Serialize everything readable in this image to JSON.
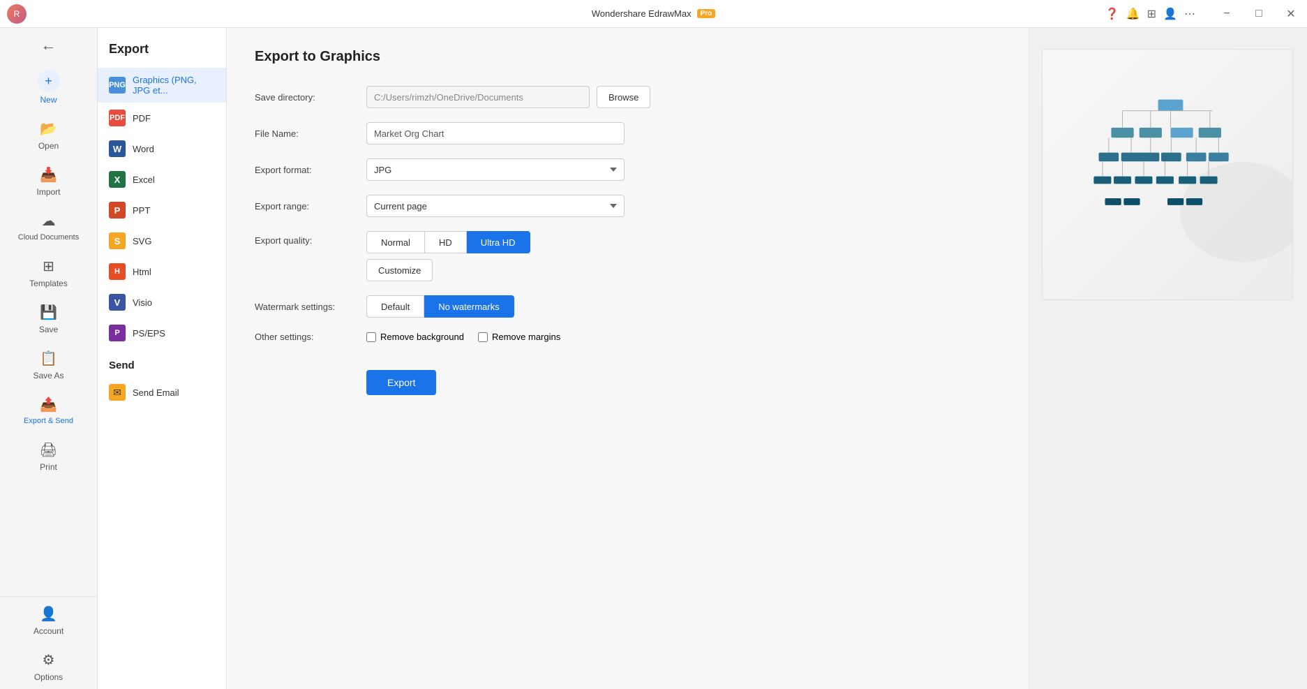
{
  "titlebar": {
    "title": "Wondershare EdrawMax",
    "pro_badge": "Pro",
    "avatar_text": "R"
  },
  "sidebar": {
    "items": [
      {
        "id": "back",
        "label": "",
        "icon": "←"
      },
      {
        "id": "new",
        "label": "New",
        "icon": "+"
      },
      {
        "id": "open",
        "label": "Open",
        "icon": "📂"
      },
      {
        "id": "import",
        "label": "Import",
        "icon": "📥"
      },
      {
        "id": "cloud",
        "label": "Cloud Documents",
        "icon": "☁"
      },
      {
        "id": "templates",
        "label": "Templates",
        "icon": "⊞"
      },
      {
        "id": "save",
        "label": "Save",
        "icon": "💾"
      },
      {
        "id": "saveas",
        "label": "Save As",
        "icon": "📋"
      },
      {
        "id": "export",
        "label": "Export & Send",
        "icon": "📤"
      },
      {
        "id": "print",
        "label": "Print",
        "icon": "🖨"
      }
    ],
    "bottom_items": [
      {
        "id": "account",
        "label": "Account",
        "icon": "👤"
      },
      {
        "id": "options",
        "label": "Options",
        "icon": "⚙"
      }
    ]
  },
  "export_sidebar": {
    "title": "Export",
    "formats": [
      {
        "id": "png",
        "label": "Graphics (PNG, JPG et...",
        "icon_class": "fi-png",
        "icon_text": "PNG"
      },
      {
        "id": "pdf",
        "label": "PDF",
        "icon_class": "fi-pdf",
        "icon_text": "PDF"
      },
      {
        "id": "word",
        "label": "Word",
        "icon_class": "fi-word",
        "icon_text": "W"
      },
      {
        "id": "excel",
        "label": "Excel",
        "icon_class": "fi-excel",
        "icon_text": "X"
      },
      {
        "id": "ppt",
        "label": "PPT",
        "icon_class": "fi-ppt",
        "icon_text": "P"
      },
      {
        "id": "svg",
        "label": "SVG",
        "icon_class": "fi-svg",
        "icon_text": "S"
      },
      {
        "id": "html",
        "label": "Html",
        "icon_class": "fi-html",
        "icon_text": "H"
      },
      {
        "id": "visio",
        "label": "Visio",
        "icon_class": "fi-visio",
        "icon_text": "V"
      },
      {
        "id": "pseps",
        "label": "PS/EPS",
        "icon_class": "fi-pseps",
        "icon_text": "P"
      }
    ],
    "send_label": "Send",
    "send_items": [
      {
        "id": "email",
        "label": "Send Email",
        "icon": "✉"
      }
    ]
  },
  "main": {
    "title": "Export to Graphics",
    "form": {
      "save_directory_label": "Save directory:",
      "save_directory_value": "C:/Users/rimzh/OneDrive/Documents",
      "browse_label": "Browse",
      "file_name_label": "File Name:",
      "file_name_value": "Market Org Chart",
      "export_format_label": "Export format:",
      "export_format_value": "JPG",
      "export_range_label": "Export range:",
      "export_range_value": "Current page",
      "export_quality_label": "Export quality:",
      "quality_normal": "Normal",
      "quality_hd": "HD",
      "quality_ultrahd": "Ultra HD",
      "quality_customize": "Customize",
      "watermark_label": "Watermark settings:",
      "watermark_default": "Default",
      "watermark_none": "No watermarks",
      "other_settings_label": "Other settings:",
      "remove_background_label": "Remove background",
      "remove_margins_label": "Remove margins",
      "export_btn_label": "Export"
    }
  }
}
